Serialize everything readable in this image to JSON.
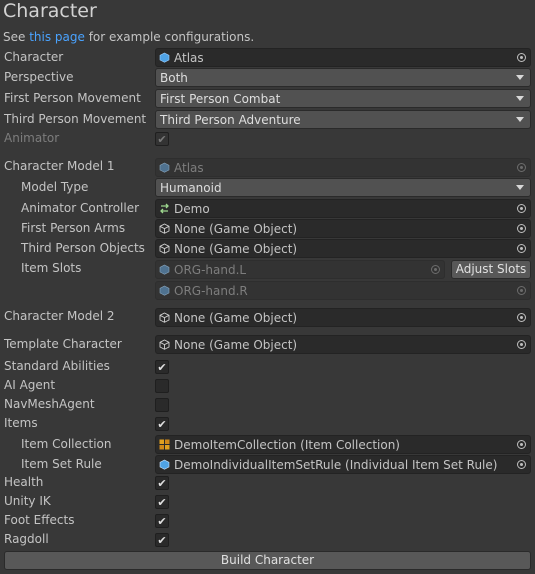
{
  "header": {
    "title": "Character",
    "see_prefix": "See ",
    "link": "this page",
    "see_suffix": " for example configurations."
  },
  "labels": {
    "character": "Character",
    "perspective": "Perspective",
    "first_person_movement": "First Person Movement",
    "third_person_movement": "Third Person Movement",
    "animator": "Animator",
    "character_model_1": "Character Model 1",
    "model_type": "Model Type",
    "animator_controller": "Animator Controller",
    "first_person_arms": "First Person Arms",
    "third_person_objects": "Third Person Objects",
    "item_slots": "Item Slots",
    "character_model_2": "Character Model 2",
    "template_character": "Template Character",
    "standard_abilities": "Standard Abilities",
    "ai_agent": "AI Agent",
    "navmesh_agent": "NavMeshAgent",
    "items": "Items",
    "item_collection": "Item Collection",
    "item_set_rule": "Item Set Rule",
    "health": "Health",
    "unity_ik": "Unity IK",
    "foot_effects": "Foot Effects",
    "ragdoll": "Ragdoll"
  },
  "values": {
    "character": "Atlas",
    "perspective": "Both",
    "first_person_movement": "First Person Combat",
    "third_person_movement": "Third Person Adventure",
    "character_model_1": "Atlas",
    "model_type": "Humanoid",
    "animator_controller": "Demo",
    "first_person_arms": "None (Game Object)",
    "third_person_objects": "None (Game Object)",
    "item_slot_1": "ORG-hand.L",
    "item_slot_2": "ORG-hand.R",
    "character_model_2": "None (Game Object)",
    "template_character": "None (Game Object)",
    "item_collection": "DemoItemCollection (Item Collection)",
    "item_set_rule": "DemoIndividualItemSetRule (Individual Item Set Rule)"
  },
  "checkboxes": {
    "animator": true,
    "standard_abilities": true,
    "ai_agent": false,
    "navmesh_agent": false,
    "items": true,
    "health": true,
    "unity_ik": true,
    "foot_effects": true,
    "ragdoll": true
  },
  "buttons": {
    "adjust_slots": "Adjust Slots",
    "build_character": "Build Character"
  },
  "check_glyph": "✔",
  "colors": {
    "background": "#383838",
    "link": "#4aa3ff",
    "prefab_icon": "#4fa3e6",
    "collection_icon": "#e0a020"
  }
}
